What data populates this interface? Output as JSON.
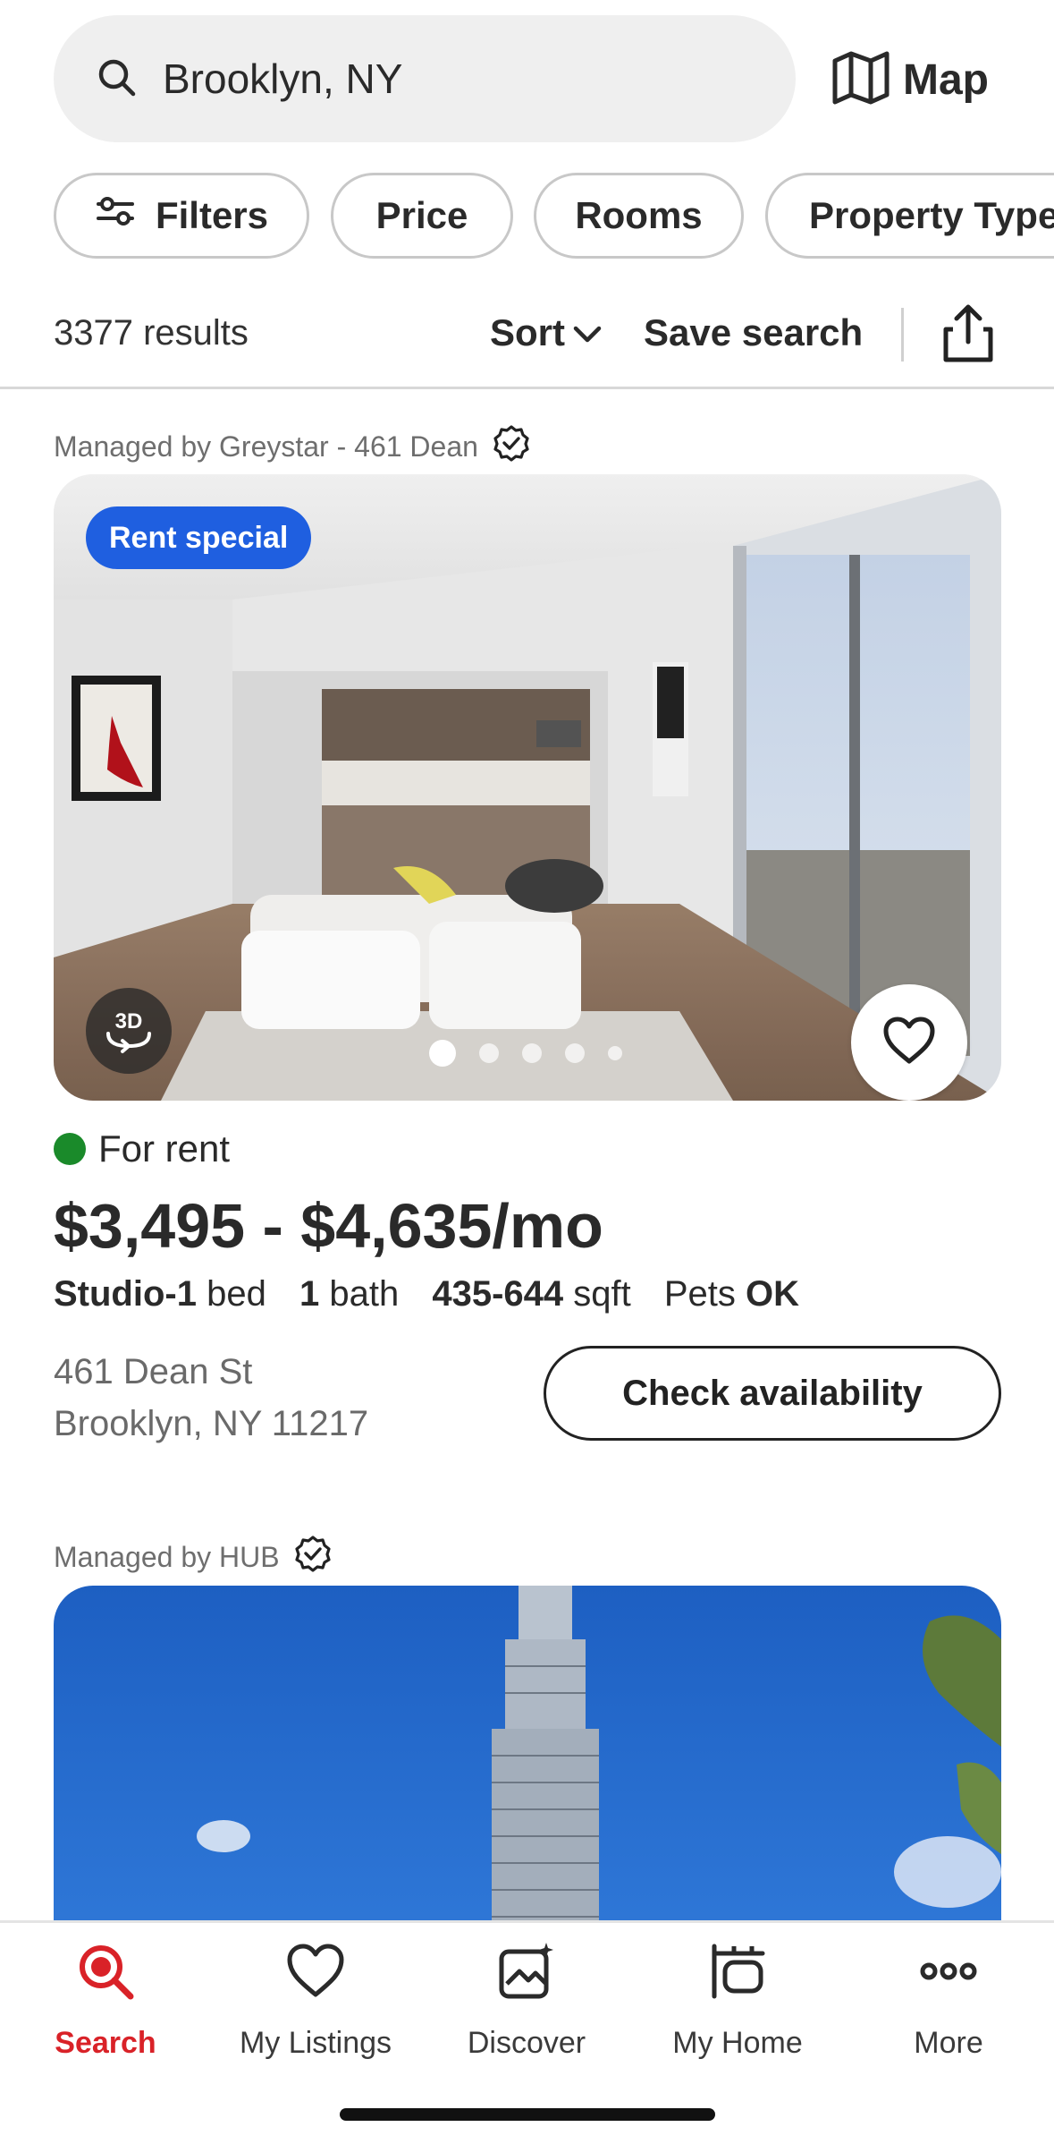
{
  "search": {
    "value": "Brooklyn, NY",
    "icon": "search-icon"
  },
  "map": {
    "label": "Map",
    "icon": "map-icon"
  },
  "filters": [
    {
      "label": "Filters",
      "icon": "sliders-icon"
    },
    {
      "label": "Price"
    },
    {
      "label": "Rooms"
    },
    {
      "label": "Property Type"
    }
  ],
  "results": {
    "count": "3377 results",
    "sort_label": "Sort",
    "save_search_label": "Save search"
  },
  "listings": [
    {
      "managed_by": "Managed by Greystar - 461 Dean",
      "badge": "Rent special",
      "badge_color": "#1f5fe0",
      "status": "For rent",
      "status_color": "#1a8a2a",
      "price": "$3,495 - $4,635/mo",
      "beds_bold": "Studio-1",
      "beds_suffix": "bed",
      "baths_bold": "1",
      "baths_suffix": "bath",
      "sqft_bold": "435-644",
      "sqft_suffix": "sqft",
      "pets_prefix": "Pets",
      "pets_bold": "OK",
      "address_line1": "461 Dean St",
      "address_line2": "Brooklyn, NY 11217",
      "cta": "Check availability",
      "photo_count": 5,
      "active_photo": 1
    },
    {
      "managed_by": "Managed by HUB"
    }
  ],
  "bottom_nav": [
    {
      "label": "Search",
      "icon": "search-icon",
      "active": true
    },
    {
      "label": "My Listings",
      "icon": "heart-icon"
    },
    {
      "label": "Discover",
      "icon": "discover-icon"
    },
    {
      "label": "My Home",
      "icon": "home-icon"
    },
    {
      "label": "More",
      "icon": "more-icon"
    }
  ],
  "colors": {
    "accent": "#d92228",
    "badge_blue": "#1f5fe0",
    "status_green": "#1a8a2a"
  }
}
